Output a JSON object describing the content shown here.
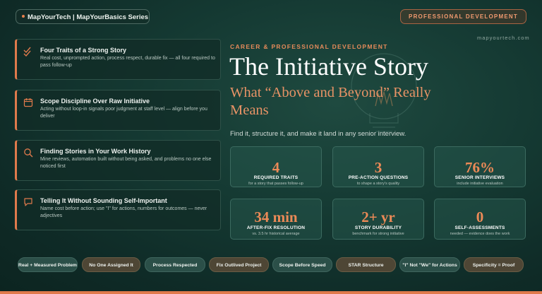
{
  "header": {
    "series": "MapYourTech | MapYourBasics Series",
    "category_badge": "PROFESSIONAL DEVELOPMENT",
    "site": "mapyourtech.com"
  },
  "colors": {
    "accent": "#e07a4c",
    "background": "#153a33",
    "title": "#ffffff",
    "subtitle": "#e89366"
  },
  "cards": [
    {
      "icon": "double-check-icon",
      "title": "Four Traits of a Strong Story",
      "desc": "Real cost, unprompted action, process respect, durable fix — all four required to pass follow-up"
    },
    {
      "icon": "calendar-icon",
      "title": "Scope Discipline Over Raw Initiative",
      "desc": "Acting without loop-in signals poor judgment at staff level — align before you deliver"
    },
    {
      "icon": "search-icon",
      "title": "Finding Stories in Your Work History",
      "desc": "Mine reviews, automation built without being asked, and problems no one else noticed first"
    },
    {
      "icon": "chat-bubble-icon",
      "title": "Telling It Without Sounding Self-Important",
      "desc": "Name cost before action; use \"I\" for actions, numbers for outcomes — never adjectives"
    }
  ],
  "hero": {
    "eyebrow": "CAREER & PROFESSIONAL DEVELOPMENT",
    "title": "The Initiative Story",
    "subtitle": "What “Above and Beyond” Really Means",
    "tagline": "Find it, structure it, and make it land in any senior interview."
  },
  "stats": [
    {
      "value": "4",
      "label": "REQUIRED TRAITS",
      "sub": "for a story that passes follow-up"
    },
    {
      "value": "3",
      "label": "PRE-ACTION QUESTIONS",
      "sub": "to shape a story's quality"
    },
    {
      "value": "76%",
      "label": "SENIOR INTERVIEWS",
      "sub": "include initiative evaluation"
    },
    {
      "value": "34 min",
      "label": "AFTER-FIX RESOLUTION",
      "sub": "vs. 3.5 hr historical average"
    },
    {
      "value": "2+ yr",
      "label": "STORY DURABILITY",
      "sub": "benchmark for strong initiative"
    },
    {
      "value": "0",
      "label": "SELF-ASSESSMENTS",
      "sub": "needed — evidence does the work"
    }
  ],
  "tags": [
    "Real + Measured Problem",
    "No One Assigned It",
    "Process Respected",
    "Fix Outlived Project",
    "Scope Before Speed",
    "STAR Structure",
    "\"I\" Not \"We\" for Actions",
    "Specificity = Proof"
  ]
}
